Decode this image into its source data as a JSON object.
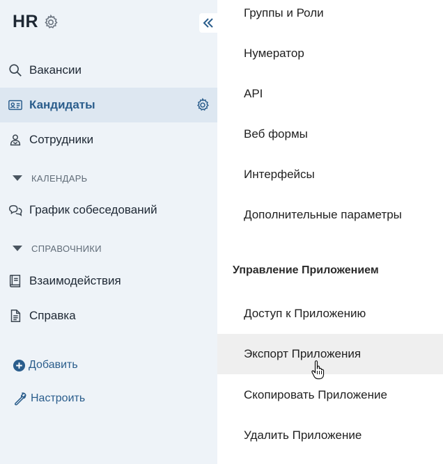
{
  "app": {
    "title": "HR",
    "settings_icon": "gear-icon",
    "collapse_icon": "double-chevron-left-icon"
  },
  "sidebar": {
    "items": [
      {
        "label": "Вакансии",
        "icon": "search-icon",
        "active": false
      },
      {
        "label": "Кандидаты",
        "icon": "id-card-icon",
        "active": true
      },
      {
        "label": "Сотрудники",
        "icon": "people-icon",
        "active": false
      }
    ],
    "sections": [
      {
        "label": "КАЛЕНДАРЬ",
        "items": [
          {
            "label": "График собеседований",
            "icon": "chat-bubbles-icon"
          }
        ]
      },
      {
        "label": "СПРАВОЧНИКИ",
        "items": [
          {
            "label": "Взаимодействия",
            "icon": "book-icon"
          },
          {
            "label": "Справка",
            "icon": "document-icon"
          }
        ]
      }
    ],
    "actions": {
      "add_label": "Добавить",
      "configure_label": "Настроить"
    }
  },
  "menu": {
    "items_top": [
      "Группы и Роли",
      "Нумератор",
      "API",
      "Веб формы",
      "Интерфейсы",
      "Дополнительные параметры"
    ],
    "section_title": "Управление Приложением",
    "items_bottom": [
      "Доступ к Приложению",
      "Экспорт Приложения",
      "Скопировать Приложение",
      "Удалить Приложение"
    ],
    "hovered_item": "Экспорт Приложения"
  },
  "colors": {
    "sidebar_bg": "#eef3f8",
    "active_bg": "#dde7f1",
    "accent": "#2a5d8c",
    "hover_bg": "#efefef"
  }
}
